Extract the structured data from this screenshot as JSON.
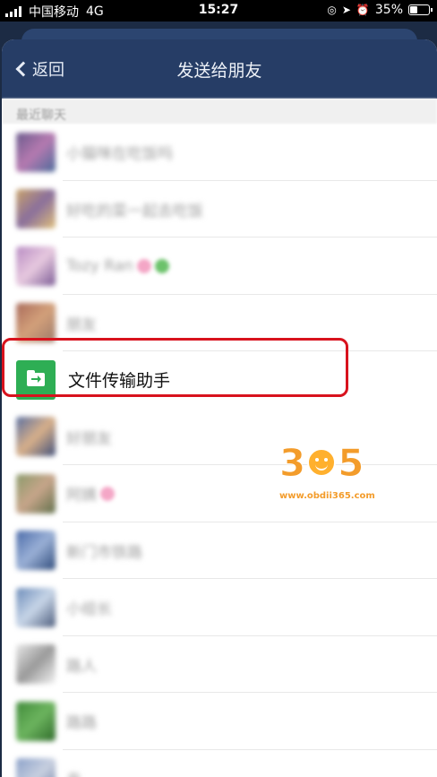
{
  "status_bar": {
    "carrier": "中国移动",
    "network": "4G",
    "time": "15:27",
    "battery": "35%"
  },
  "nav": {
    "back_label": "返回",
    "title": "发送给朋友"
  },
  "section": {
    "title": "最近聊天"
  },
  "contacts": [
    {
      "name": "小猫咪在吃饭吗",
      "blurred": true
    },
    {
      "name": "好吃的菜一起去吃饭",
      "blurred": true
    },
    {
      "name": "Tozy Ran",
      "blurred": true
    },
    {
      "name": "朋友",
      "blurred": true
    },
    {
      "name": "文件传输助手",
      "blurred": false,
      "highlighted": true
    },
    {
      "name": "好朋友",
      "blurred": true
    },
    {
      "name": "阿姨",
      "blurred": true
    },
    {
      "name": "新门市铁路",
      "blurred": true
    },
    {
      "name": "小组长",
      "blurred": true
    },
    {
      "name": "路人",
      "blurred": true
    },
    {
      "name": "路路",
      "blurred": true
    },
    {
      "name": "亲",
      "blurred": true
    }
  ],
  "watermark": {
    "digit1": "3",
    "digit2": "5",
    "url": "www.obdii365.com"
  },
  "colors": {
    "nav_bg": "#263d66",
    "file_icon_bg": "#2eae54",
    "highlight_border": "#d8121d"
  }
}
